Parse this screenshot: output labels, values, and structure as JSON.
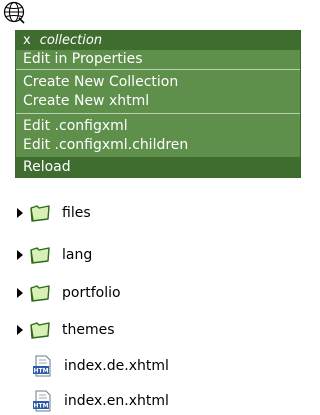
{
  "context_menu": {
    "close_glyph": "x",
    "target_name": "collection",
    "items_group1": [
      "Edit in Properties"
    ],
    "items_group2": [
      "Create New Collection",
      "Create New xhtml"
    ],
    "items_group3": [
      "Edit .configxml",
      "Edit .configxml.children"
    ],
    "reload_label": "Reload"
  },
  "tree": {
    "folders": [
      "files",
      "lang",
      "portfolio",
      "themes"
    ],
    "files": [
      "index.de.xhtml",
      "index.en.xhtml"
    ]
  },
  "colors": {
    "menu_bg": "#5e8f4b",
    "menu_dark": "#3f6d30",
    "folder_fill": "#d6f0b6",
    "folder_stroke": "#2d6a1c"
  }
}
